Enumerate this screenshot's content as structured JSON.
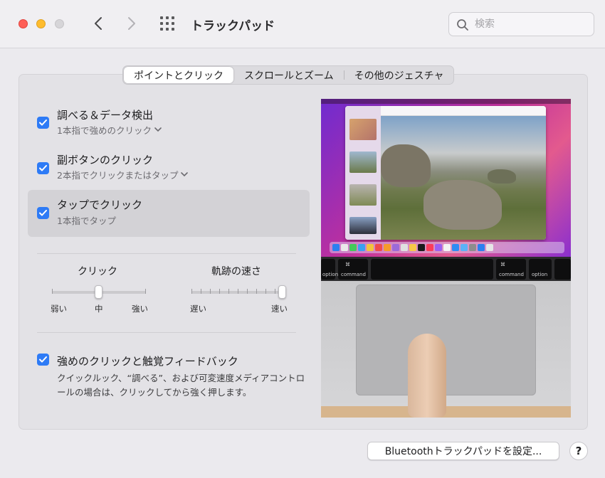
{
  "window": {
    "title": "トラックパッド"
  },
  "search": {
    "placeholder": "検索"
  },
  "tabs": [
    {
      "label": "ポイントとクリック",
      "active": true
    },
    {
      "label": "スクロールとズーム",
      "active": false
    },
    {
      "label": "その他のジェスチャ",
      "active": false
    }
  ],
  "options": [
    {
      "title": "調べる＆データ検出",
      "subtitle": "1本指で強めのクリック",
      "checked": true,
      "has_dropdown": true
    },
    {
      "title": "副ボタンのクリック",
      "subtitle": "2本指でクリックまたはタップ",
      "checked": true,
      "has_dropdown": true
    },
    {
      "title": "タップでクリック",
      "subtitle": "1本指でタップ",
      "checked": true,
      "has_dropdown": false,
      "selected": true
    }
  ],
  "sliders": {
    "click": {
      "label": "クリック",
      "min_label": "弱い",
      "mid_label": "中",
      "max_label": "強い",
      "value": 0.5
    },
    "tracking": {
      "label": "軌跡の速さ",
      "min_label": "遅い",
      "max_label": "速い",
      "value": 1.0
    }
  },
  "force_click": {
    "title": "強めのクリックと触覚フィードバック",
    "description": "クイックルック、“調べる”、および可変速度メディアコントロールの場合は、クリックしてから強く押します。",
    "checked": true
  },
  "footer": {
    "bluetooth_button": "Bluetoothトラックパッドを設定...",
    "help_button": "?"
  },
  "preview_keys": {
    "left_option": "option",
    "left_command": "command",
    "right_command": "command",
    "right_option": "option",
    "cmd_symbol": "⌘"
  },
  "colors": {
    "accent": "#2e7bf6",
    "close": "#fe5f57",
    "minimize": "#febc2e"
  }
}
